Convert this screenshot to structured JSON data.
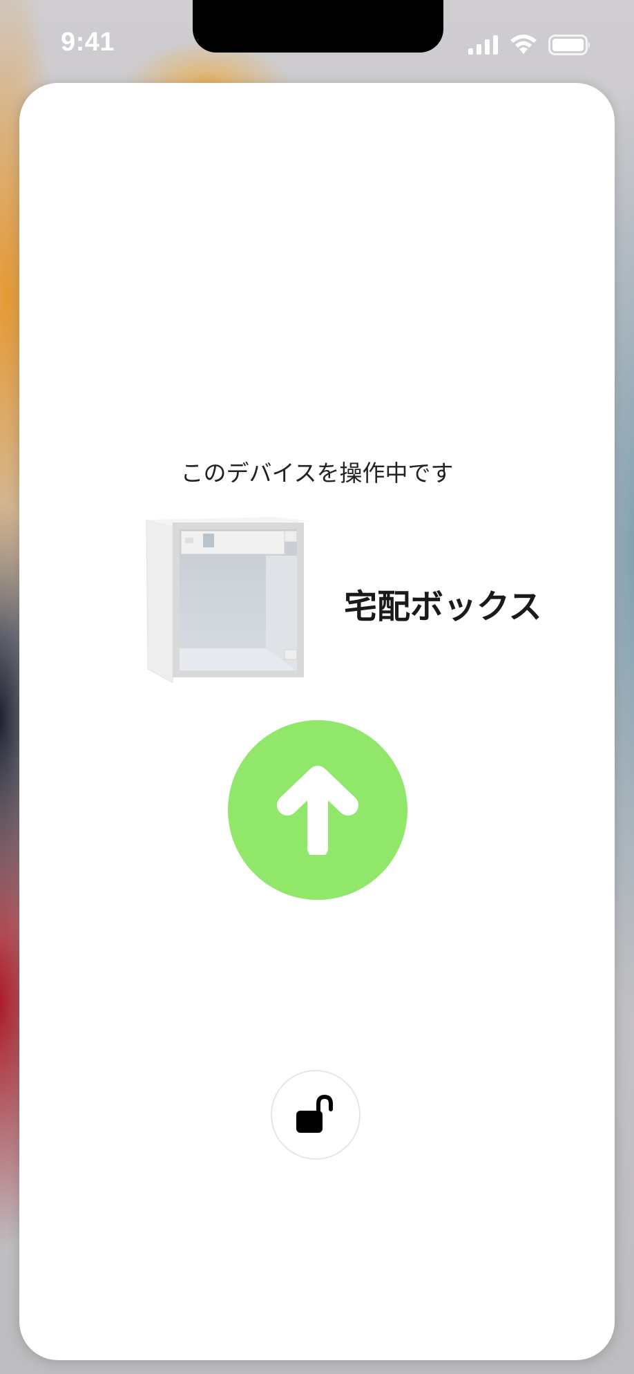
{
  "status_bar": {
    "time": "9:41",
    "signal_icon": "cellular-signal-icon",
    "wifi_icon": "wifi-icon",
    "battery_icon": "battery-icon"
  },
  "screen": {
    "operating_label": "このデバイスを操作中です",
    "device": {
      "name": "宅配ボックス",
      "image_icon": "delivery-box-illustration"
    },
    "primary_action": {
      "icon": "arrow-up-icon",
      "color": "#90e76a"
    },
    "lock_action": {
      "icon": "unlock-icon"
    }
  }
}
